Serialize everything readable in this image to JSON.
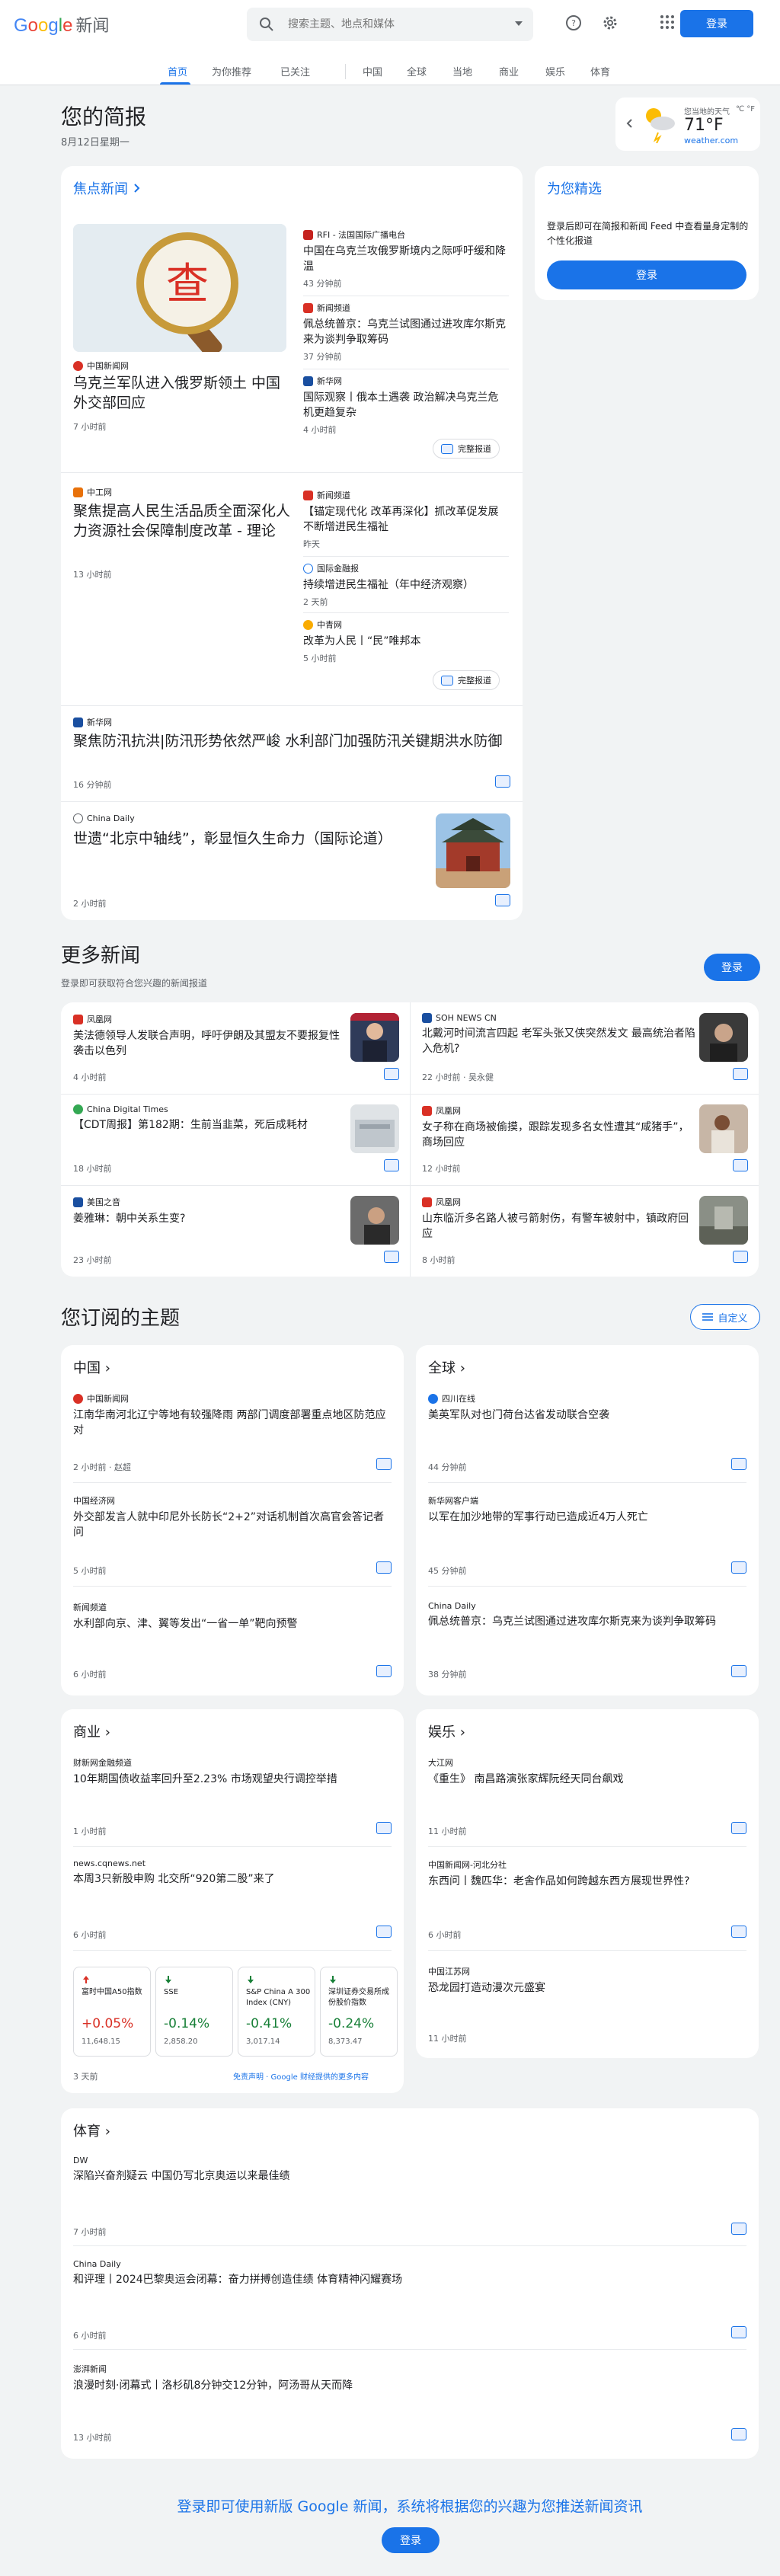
{
  "header": {
    "logo_google": "Google",
    "logo_news": "新闻",
    "search_placeholder": "搜索主题、地点和媒体",
    "signin_label": "登录",
    "tabs": [
      "首页",
      "为你推荐",
      "已关注",
      "中国",
      "全球",
      "当地",
      "商业",
      "娱乐",
      "体育"
    ]
  },
  "briefing": {
    "title": "您的简报",
    "date": "8月12日星期一"
  },
  "weather": {
    "label": "您当地的天气",
    "temp": "71°F",
    "unit_c": "℃",
    "unit_f": "°F",
    "source": "weather.com"
  },
  "top_stories": {
    "title": "焦点新闻",
    "clusters": [
      {
        "main": {
          "source": "中国新闻网",
          "title": "乌克兰军队进入俄罗斯领土 中国外交部回应",
          "time": "7 小时前",
          "thumb_text": "查"
        },
        "side": [
          {
            "source": "RFI - 法国国际广播电台",
            "title": "中国在乌克兰攻俄罗斯境内之际呼吁缓和降温",
            "time": "43 分钟前"
          },
          {
            "source": "新闻频道",
            "title": "佩总统普京：乌克兰试图通过进攻库尔斯克来为谈判争取筹码",
            "time": "37 分钟前"
          },
          {
            "source": "新华网",
            "title": "国际观察丨俄本土遇袭 政治解决乌克兰危机更趋复杂",
            "time": "4 小时前"
          }
        ],
        "full_coverage": "完整报道"
      },
      {
        "main": {
          "source": "中工网",
          "title": "聚焦提高人民生活品质全面深化人力资源社会保障制度改革 - 理论",
          "time": "13 小时前"
        },
        "side": [
          {
            "source": "新闻频道",
            "title": "【锚定现代化 改革再深化】抓改革促发展 不断增进民生福祉",
            "time": "昨天"
          },
          {
            "source": "国际金融报",
            "title": "持续增进民生福祉（年中经济观察）",
            "time": "2 天前"
          },
          {
            "source": "中青网",
            "title": "改革为人民丨“民”唯邦本",
            "time": "5 小时前"
          }
        ],
        "full_coverage": "完整报道"
      }
    ],
    "singles": [
      {
        "source": "新华网",
        "title": "聚焦防汛抗洪|防汛形势依然严峻 水利部门加强防汛关键期洪水防御",
        "time": "16 分钟前"
      },
      {
        "source": "China Daily",
        "title": "世遗“北京中轴线”，彰显恒久生命力（国际论道）",
        "time": "2 小时前"
      }
    ]
  },
  "for_you": {
    "title": "为您精选",
    "desc": "登录后即可在简报和新闻 Feed 中查看量身定制的个性化报道",
    "signin_label": "登录"
  },
  "more_news": {
    "title": "更多新闻",
    "subtitle": "登录即可获取符合您兴趣的新闻报道",
    "signin_label": "登录",
    "items": [
      {
        "source": "凤凰网",
        "title": "美法德领导人发联合声明，呼吁伊朗及其盟友不要报复性袭击以色列",
        "time": "4 小时前"
      },
      {
        "source": "SOH NEWS CN",
        "title": "北戴河时间流言四起 老军头张又侠突然发文 最高统治者陷入危机?",
        "time": "22 小时前 · 吴永健"
      },
      {
        "source": "China Digital Times",
        "title": "【CDT周报】第182期：生前当韭菜，死后成耗材",
        "time": "18 小时前"
      },
      {
        "source": "凤凰网",
        "title": "女子称在商场被偷摸，跟踪发现多名女性遭其“咸猪手”，商场回应",
        "time": "12 小时前"
      },
      {
        "source": "美国之音",
        "title": "姜雅琳：朝中关系生变?",
        "time": "23 小时前"
      },
      {
        "source": "凤凰网",
        "title": "山东临沂多名路人被弓箭射伤，有警车被射中，镇政府回应",
        "time": "8 小时前"
      }
    ]
  },
  "topics": {
    "title": "您订阅的主题",
    "customize_label": "自定义",
    "china": {
      "title": "中国",
      "items": [
        {
          "source": "中国新闻网",
          "title": "江南华南河北辽宁等地有较强降雨 两部门调度部署重点地区防范应对",
          "time": "2 小时前 · 赵超"
        },
        {
          "source": "中国经济网",
          "title": "外交部发言人就中印尼外长防长“2+2”对话机制首次高官会答记者问",
          "time": "5 小时前"
        },
        {
          "source": "新闻频道",
          "title": "水利部向京、津、翼等发出“一省一单”靶向预警",
          "time": "6 小时前"
        }
      ]
    },
    "world": {
      "title": "全球",
      "items": [
        {
          "source": "四川在线",
          "title": "美英军队对也门荷台达省发动联合空袭",
          "time": "44 分钟前"
        },
        {
          "source": "新华网客户端",
          "title": "以军在加沙地带的军事行动已造成近4万人死亡",
          "time": "45 分钟前"
        },
        {
          "source": "China Daily",
          "title": "佩总统普京：乌克兰试图通过进攻库尔斯克来为谈判争取筹码",
          "time": "38 分钟前"
        }
      ]
    },
    "business": {
      "title": "商业",
      "items": [
        {
          "source": "财新网金融频道",
          "title": "10年期国债收益率回升至2.23% 市场观望央行调控举措",
          "time": "1 小时前"
        },
        {
          "source": "news.cqnews.net",
          "title": "本周3只新股申购 北交所“920第二股”来了",
          "time": "6 小时前"
        }
      ],
      "markets": [
        {
          "name": "富时中国A50指数",
          "change": "+0.05%",
          "value": "11,648.15",
          "color": "#d93025"
        },
        {
          "name": "SSE",
          "change": "-0.14%",
          "value": "2,858.20",
          "color": "#188038"
        },
        {
          "name": "S&P China A 300 Index (CNY)",
          "change": "-0.41%",
          "value": "3,017.14",
          "color": "#188038"
        },
        {
          "name": "深圳证券交易所成份股价指数",
          "change": "-0.24%",
          "value": "8,373.47",
          "color": "#188038"
        }
      ],
      "market_time": "3 天前",
      "disclaimer": "免责声明 · Google 财经提供的更多内容"
    },
    "entertainment": {
      "title": "娱乐",
      "items": [
        {
          "source": "大江网",
          "title": "《重生》 南昌路演张家辉阮经天同台飙戏",
          "time": "11 小时前"
        },
        {
          "source": "中国新闻网-河北分社",
          "title": "东西问丨魏匹华：老舍作品如何跨越东西方展现世界性?",
          "time": "6 小时前"
        },
        {
          "source": "中国江苏网",
          "title": "恐龙园打造动漫次元盛宴",
          "time": "11 小时前"
        }
      ]
    },
    "sports": {
      "title": "体育",
      "items": [
        {
          "source": "DW",
          "title": "深陷兴奋剂疑云 中国仍写北京奥运以来最佳绩",
          "time": "7 小时前"
        },
        {
          "source": "China Daily",
          "title": "和评理丨2024巴黎奥运会闭幕：奋力拼搏创造佳绩 体育精神闪耀赛场",
          "time": "6 小时前"
        },
        {
          "source": "澎湃新闻",
          "title": "浪漫时刻·闭幕式丨洛杉矶8分钟交12分钟，阿汤哥从天而降",
          "time": "13 小时前"
        }
      ]
    }
  },
  "footer": {
    "text": "登录即可使用新版 Google 新闻，系统将根据您的兴趣为您推送新闻资讯",
    "signin_label": "登录"
  },
  "colors": {
    "accent": "#1a73e8",
    "up": "#d93025",
    "down": "#188038"
  }
}
